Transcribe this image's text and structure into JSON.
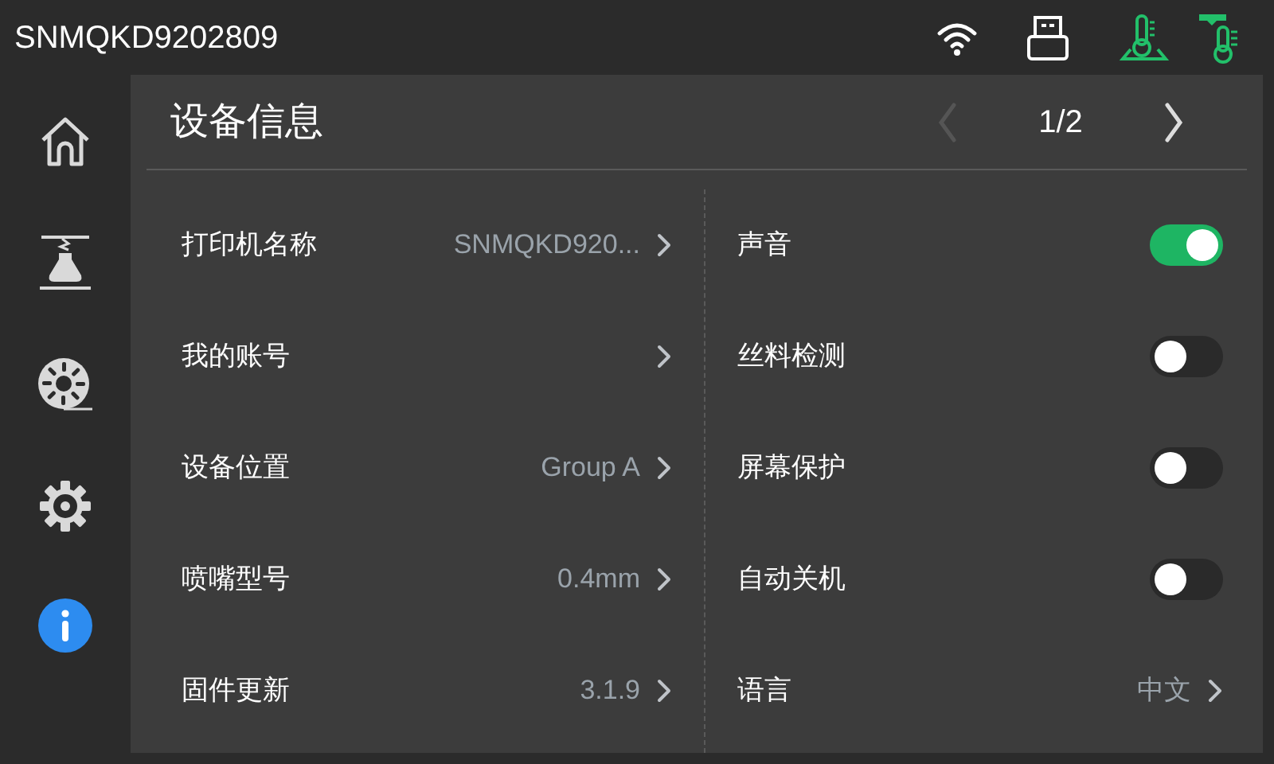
{
  "status_bar": {
    "device_name": "SNMQKD9202809"
  },
  "sidebar": {
    "items": [
      {
        "kind": "home",
        "selected": false
      },
      {
        "kind": "printer",
        "selected": false
      },
      {
        "kind": "filament",
        "selected": false
      },
      {
        "kind": "settings",
        "selected": false
      },
      {
        "kind": "info",
        "selected": true
      }
    ]
  },
  "panel": {
    "title": "设备信息",
    "pager": {
      "page": "1/2",
      "prev_disabled": true,
      "next_disabled": false
    },
    "left_rows": [
      {
        "label": "打印机名称",
        "value": "SNMQKD920..."
      },
      {
        "label": "我的账号"
      },
      {
        "label": "设备位置",
        "value": "Group A"
      },
      {
        "label": "喷嘴型号",
        "value": "0.4mm"
      },
      {
        "label": "固件更新",
        "value": "3.1.9"
      }
    ],
    "right_rows": [
      {
        "kind": "toggle",
        "label": "声音",
        "on": true
      },
      {
        "kind": "toggle",
        "label": "丝料检测",
        "on": false
      },
      {
        "kind": "toggle",
        "label": "屏幕保护",
        "on": false
      },
      {
        "kind": "toggle",
        "label": "自动关机",
        "on": false
      },
      {
        "kind": "link",
        "label": "语言",
        "value": "中文"
      }
    ]
  }
}
